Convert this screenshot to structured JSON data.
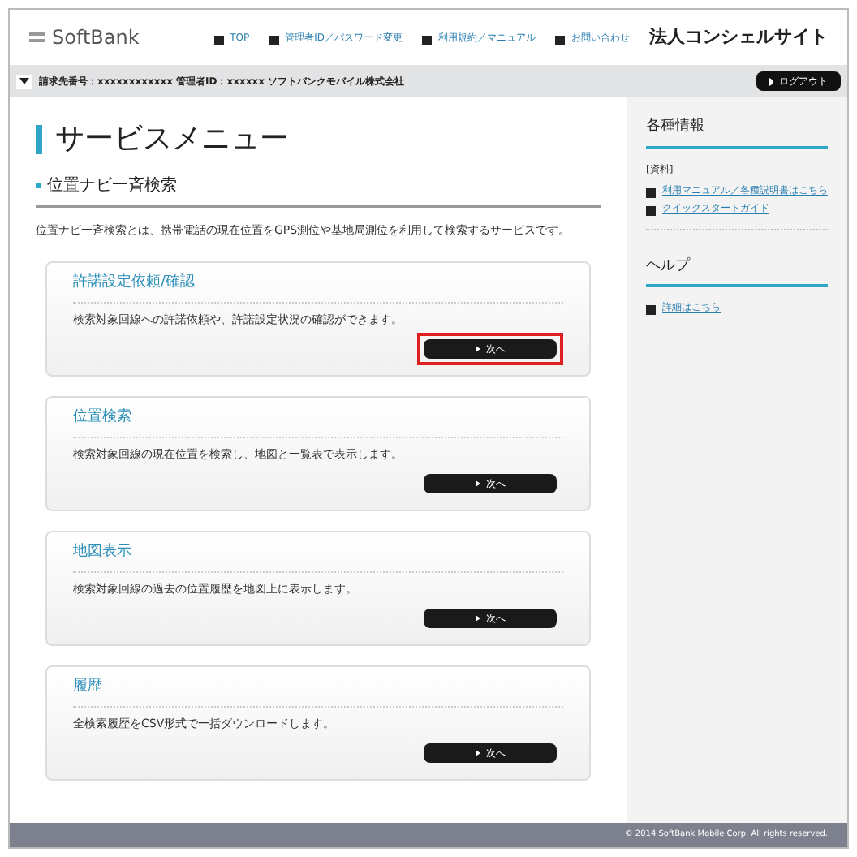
{
  "header": {
    "logo": "SoftBank",
    "nav": [
      "TOP",
      "管理者ID／パスワード変更",
      "利用規約／マニュアル",
      "お問い合わせ"
    ],
    "site_title": "法人コンシェルサイト"
  },
  "account_bar": {
    "info": "請求先番号：xxxxxxxxxxxx 管理者ID：xxxxxx ソフトバンクモバイル株式会社",
    "logout": "ログアウト"
  },
  "main": {
    "title": "サービスメニュー",
    "subtitle": "位置ナビ一斉検索",
    "description": "位置ナビ一斉検索とは、携帯電話の現在位置をGPS測位や基地局測位を利用して検索するサービスです。",
    "cards": [
      {
        "title": "許諾設定依頼/確認",
        "text": "検索対象回線への許諾依頼や、許諾設定状況の確認ができます。",
        "button": "次へ",
        "highlighted": true
      },
      {
        "title": "位置検索",
        "text": "検索対象回線の現在位置を検索し、地図と一覧表で表示します。",
        "button": "次へ",
        "highlighted": false
      },
      {
        "title": "地図表示",
        "text": "検索対象回線の過去の位置履歴を地図上に表示します。",
        "button": "次へ",
        "highlighted": false
      },
      {
        "title": "履歴",
        "text": "全検索履歴をCSV形式で一括ダウンロードします。",
        "button": "次へ",
        "highlighted": false
      }
    ]
  },
  "sidebar": {
    "sections": [
      {
        "title": "各種情報",
        "label": "[資料]",
        "links": [
          "利用マニュアル／各種説明書はこちら",
          "クイックスタートガイド"
        ]
      },
      {
        "title": "ヘルプ",
        "links": [
          "詳細はこちら"
        ]
      }
    ]
  },
  "footer": "© 2014 SoftBank Mobile Corp. All rights reserved."
}
